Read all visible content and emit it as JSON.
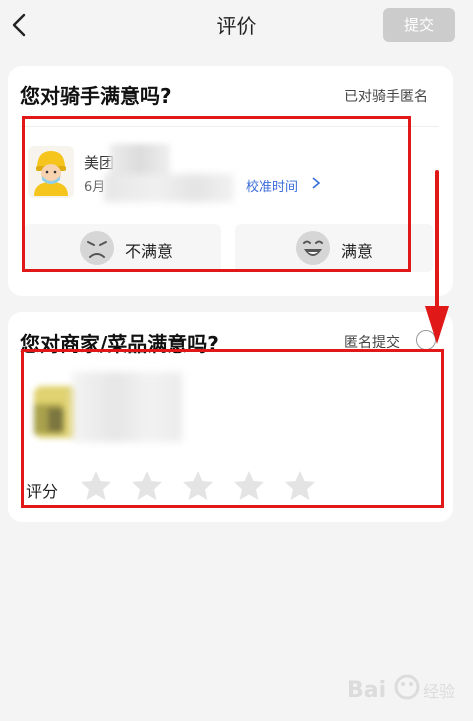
{
  "nav": {
    "title": "评价",
    "submit_label": "提交"
  },
  "rider": {
    "question": "您对骑手满意吗?",
    "anonymous_label": "已对骑手匿名",
    "name": "美团",
    "date": "6月",
    "calibrate_label": "校准时间",
    "dissatisfied_label": "不满意",
    "satisfied_label": "满意"
  },
  "merchant": {
    "question": "您对商家/菜品满意吗?",
    "anonymous_label": "匿名提交",
    "score_label": "评分",
    "star_count": 5,
    "rating": 0
  },
  "watermark": {
    "text": "Bai经验"
  },
  "colors": {
    "highlight": "#e01818",
    "link": "#3a6ed8",
    "disabled_button": "#cccccc"
  },
  "icons": [
    "back-arrow-icon",
    "chevron-right-icon",
    "angry-face-icon",
    "happy-face-icon",
    "star-icon",
    "rider-avatar-icon"
  ]
}
